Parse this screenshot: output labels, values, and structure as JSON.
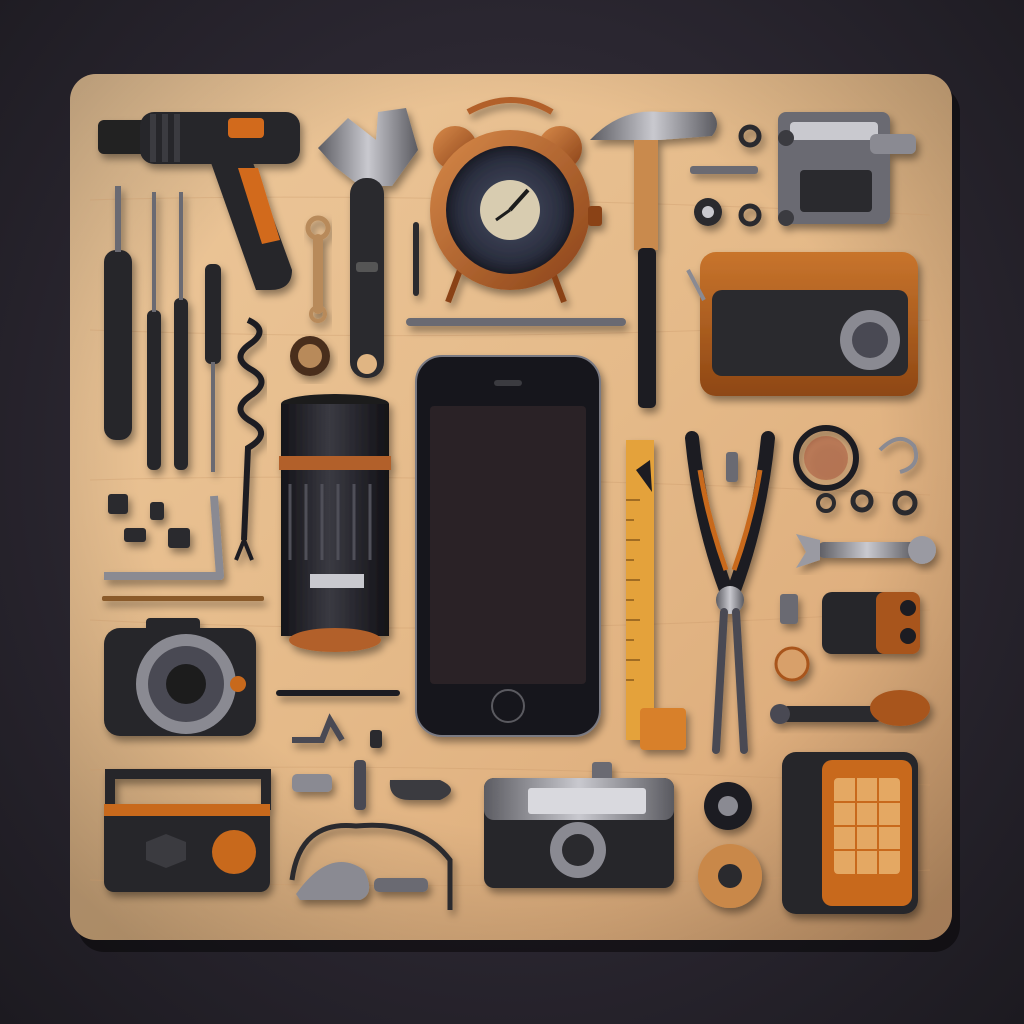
{
  "scene": {
    "description": "",
    "colors": {
      "background": "#2a2630",
      "board": "#e3b98a",
      "board_edge": "#c99466",
      "metal": "#6b6b72",
      "metal_light": "#bfbfc6",
      "black": "#1e1c20",
      "orange": "#c8691f",
      "leather": "#b0601e",
      "copper": "#b2612a",
      "screen": "#2a2226"
    },
    "objects": [
      "cordless-drill",
      "adjustable-wrench",
      "alarm-clock",
      "claw-hammer",
      "bench-vise",
      "leather-wallet",
      "screwdrivers",
      "coil-spring",
      "smartphone",
      "camera-lens",
      "ruler",
      "pliers",
      "combination-wrench",
      "compact-camera",
      "rangefinder-camera",
      "vintage-radio",
      "leather-pouch",
      "hand-tool-knob",
      "allen-key",
      "small-hardware"
    ]
  }
}
